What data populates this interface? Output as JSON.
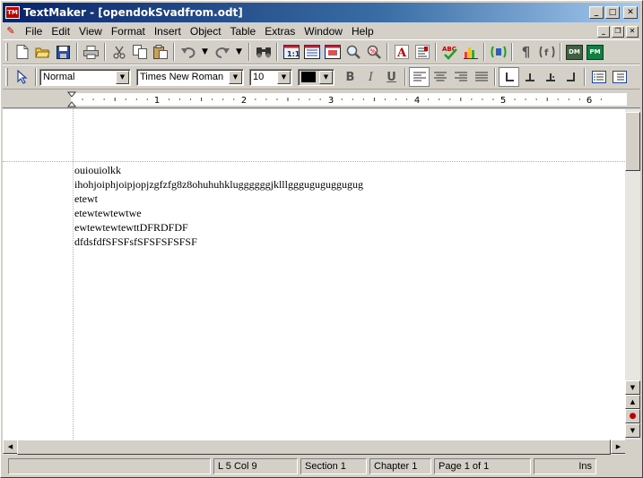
{
  "window": {
    "title": "TextMaker - [opendokSvadfrom.odt]",
    "logo": "TM",
    "minimize": "_",
    "maximize": "□",
    "close": "✕"
  },
  "menu": {
    "items": [
      "File",
      "Edit",
      "View",
      "Format",
      "Insert",
      "Object",
      "Table",
      "Extras",
      "Window",
      "Help"
    ],
    "doc_minimize": "_",
    "doc_restore": "❐",
    "doc_close": "✕"
  },
  "toolbar_standard": {
    "icons": [
      "new-document-icon",
      "open-folder-icon",
      "save-icon",
      "print-icon",
      "cut-icon",
      "copy-icon",
      "paste-icon",
      "undo-icon",
      "redo-icon",
      "find-icon",
      "page-view-icon",
      "normal-view-icon",
      "outline-view-icon",
      "zoom-icon",
      "zoom-percent-icon",
      "font-icon",
      "paragraph-icon",
      "spellcheck-icon",
      "chart-icon",
      "objects-icon",
      "pilcrow-icon",
      "field-icon",
      "datamaker-icon",
      "planmaker-icon"
    ],
    "dm_label": "DM",
    "pm_label": "PM"
  },
  "toolbar_format": {
    "style": "Normal",
    "font": "Times New Roman",
    "size": "10",
    "text_color": "#000000",
    "bold": "B",
    "italic": "I",
    "underline": "U"
  },
  "ruler": {
    "numbers": [
      "1",
      "2",
      "3",
      "4",
      "5",
      "6"
    ]
  },
  "document": {
    "lines": [
      "ouiouiolkk",
      "ihohjoiphjoipjopjzgfzfg8z8ohuhuhkluggggggjklllggguguguggugug",
      "etewt",
      "etewtewtewtwe",
      "ewtewtewtewttDFRDFDF",
      "dfdsfdfSFSFsfSFSFSFSFSF"
    ]
  },
  "status": {
    "panel1": "",
    "position": "L 5 Col 9",
    "section": "Section 1",
    "chapter": "Chapter 1",
    "page": "Page 1 of 1",
    "mode": "Ins"
  }
}
